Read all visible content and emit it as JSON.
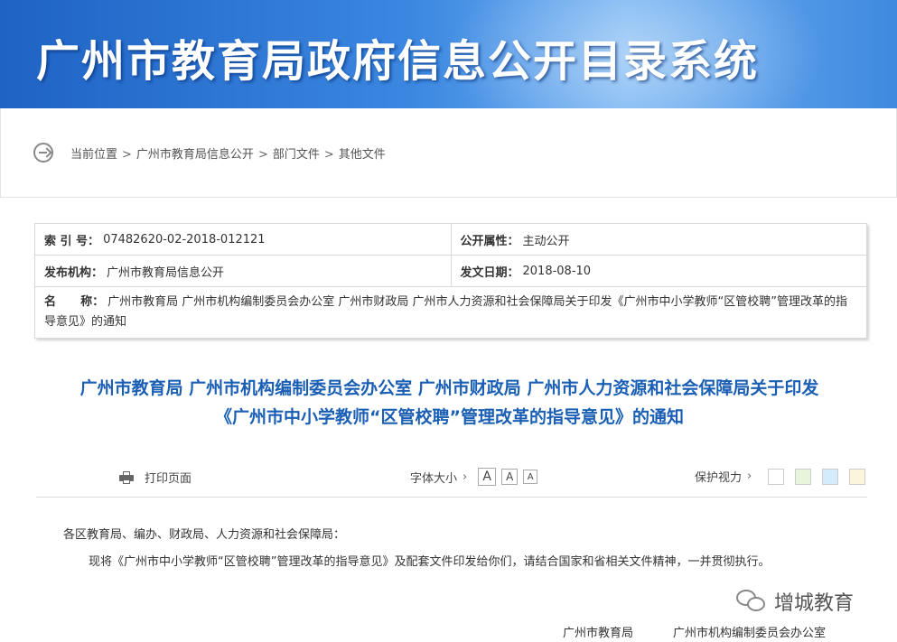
{
  "banner": {
    "title": "广州市教育局政府信息公开目录系统"
  },
  "breadcrumb": {
    "icon": "arrow-circle-right-icon",
    "items": [
      "当前位置",
      "广州市教育局信息公开",
      "部门文件",
      "其他文件"
    ],
    "separator": ">"
  },
  "meta": {
    "index_label": "索 引 号：",
    "index_value": "07482620-02-2018-012121",
    "attr_label": "公开属性：",
    "attr_value": "主动公开",
    "org_label": "发布机构：",
    "org_value": "广州市教育局信息公开",
    "date_label": "发文日期：",
    "date_value": "2018-08-10",
    "name_label": "名      称：",
    "name_value": "广州市教育局 广州市机构编制委员会办公室 广州市财政局 广州市人力资源和社会保障局关于印发《广州市中小学教师“区管校聘”管理改革的指导意见》的通知"
  },
  "doc": {
    "title_line1": "广州市教育局 广州市机构编制委员会办公室 广州市财政局 广州市人力资源和社会保障局关于印发",
    "title_line2": "《广州市中小学教师“区管校聘”管理改革的指导意见》的通知"
  },
  "toolbar": {
    "print_label": "打印页面",
    "fontsize_label": "字体大小",
    "font_large": "A",
    "font_medium": "A",
    "font_small": "A",
    "eye_label": "保护视力",
    "swatches": [
      "#ffffff",
      "#e6f5dc",
      "#d3ebfa",
      "#fbf5dc"
    ]
  },
  "body": {
    "salutation": "各区教育局、编办、财政局、人力资源和社会保障局：",
    "paragraph1": "现将《广州市中小学教师“区管校聘”管理改革的指导意见》及配套文件印发给你们，请结合国家和省相关文件精神，一并贯彻执行。"
  },
  "signatures": [
    "广州市教育局",
    "广州市机构编制委员会办公室"
  ],
  "watermark": {
    "text": "增城教育",
    "icon": "wechat-icon"
  }
}
